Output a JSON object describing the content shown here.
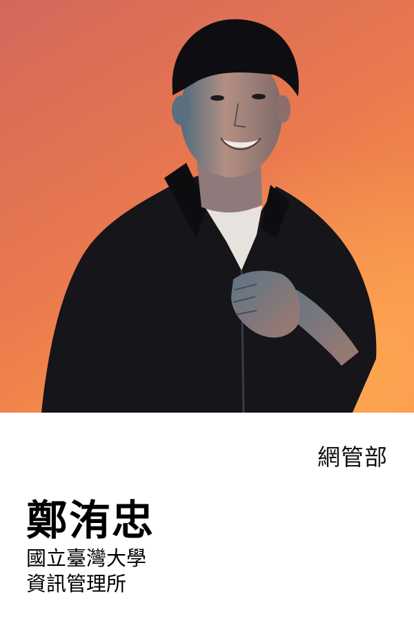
{
  "department": "網管部",
  "name": "鄭洧忠",
  "affiliation": {
    "line1": "國立臺灣大學",
    "line2": "資訊管理所"
  },
  "colors": {
    "background_top": "#d7695a",
    "background_bottom": "#f7904a",
    "shirt": "#15151a",
    "panel": "#ffffff",
    "text": "#000000"
  }
}
